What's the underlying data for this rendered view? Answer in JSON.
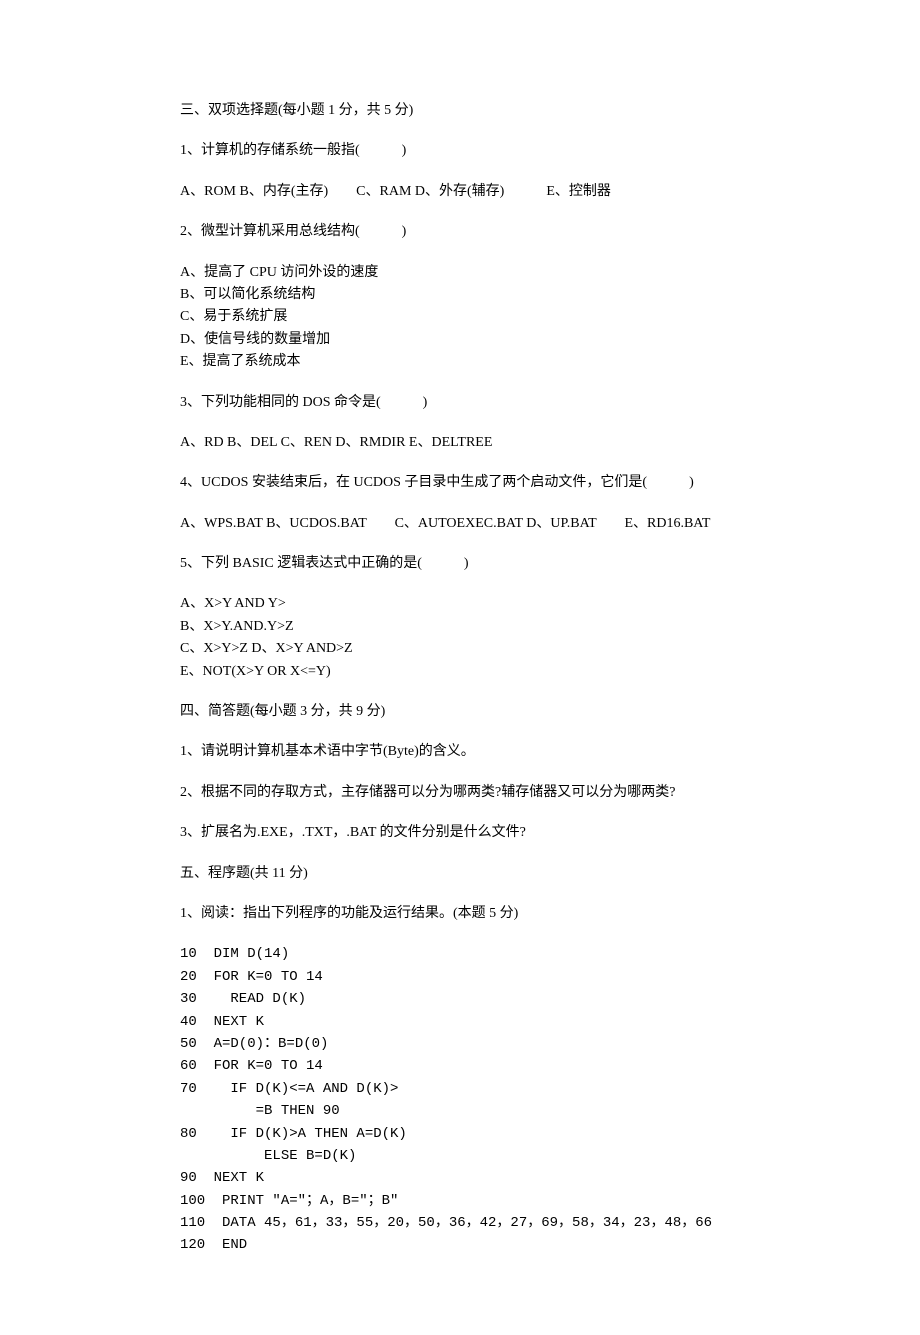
{
  "section3": {
    "title": "三、双项选择题(每小题 1 分，共 5 分)",
    "q1": {
      "stem": "1、计算机的存储系统一般指(　　　)",
      "opts": "A、ROM  B、内存(主存)　　C、RAM  D、外存(辅存)　　　E、控制器"
    },
    "q2": {
      "stem": "2、微型计算机采用总线结构(　　　)",
      "optA": "A、提高了 CPU 访问外设的速度",
      "optB": "B、可以简化系统结构",
      "optC": "C、易于系统扩展",
      "optD": "D、使信号线的数量增加",
      "optE": "E、提高了系统成本"
    },
    "q3": {
      "stem": "3、下列功能相同的 DOS 命令是(　　　)",
      "opts": "A、RD  B、DEL  C、REN  D、RMDIR  E、DELTREE"
    },
    "q4": {
      "stem": "4、UCDOS 安装结束后，在 UCDOS 子目录中生成了两个启动文件，它们是(　　　)",
      "opts": "A、WPS.BAT  B、UCDOS.BAT　　C、AUTOEXEC.BAT  D、UP.BAT　　E、RD16.BAT"
    },
    "q5": {
      "stem": "5、下列 BASIC 逻辑表达式中正确的是(　　　)",
      "optA": "A、X>Y AND Y>",
      "optB": "B、X>Y.AND.Y>Z",
      "optC": "C、X>Y>Z  D、X>Y AND>Z",
      "optE": "E、NOT(X>Y OR X<=Y)"
    }
  },
  "section4": {
    "title": "四、简答题(每小题 3 分，共 9 分)",
    "q1": "1、请说明计算机基本术语中字节(Byte)的含义。",
    "q2": "2、根据不同的存取方式，主存储器可以分为哪两类?辅存储器又可以分为哪两类?",
    "q3": "3、扩展名为.EXE，.TXT，.BAT 的文件分别是什么文件?"
  },
  "section5": {
    "title": "五、程序题(共 11 分)",
    "q1": {
      "stem": "1、阅读：指出下列程序的功能及运行结果。(本题 5 分)",
      "code": "10  DIM D(14)\n20  FOR K=0 TO 14\n30    READ D(K)\n40  NEXT K\n50  A=D(0)：B=D(0)\n60  FOR K=0 TO 14\n70    IF D(K)<=A AND D(K)>\n         =B THEN 90\n80    IF D(K)>A THEN A=D(K)\n          ELSE B=D(K)\n90  NEXT K\n100  PRINT ″A=″；A，B=″；B″\n110  DATA 45，61，33，55，20，50，36，42，27，69，58，34，23，48，66\n120  END"
    }
  }
}
